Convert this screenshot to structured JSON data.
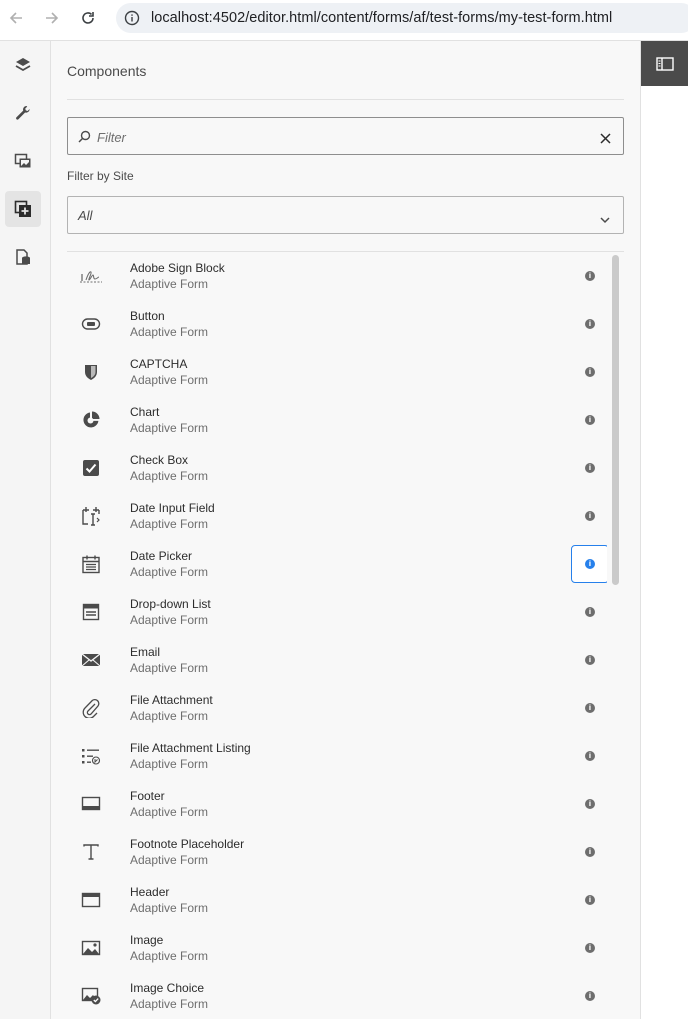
{
  "browser": {
    "url": "localhost:4502/editor.html/content/forms/af/test-forms/my-test-form.html"
  },
  "rail": {
    "items": [
      {
        "icon": "layers-icon"
      },
      {
        "icon": "wrench-icon"
      },
      {
        "icon": "assets-icon"
      },
      {
        "icon": "components-add-icon",
        "active": true
      },
      {
        "icon": "data-sources-icon"
      }
    ]
  },
  "panel": {
    "title": "Components",
    "filter_placeholder": "Filter",
    "site_label": "Filter by Site",
    "site_value": "All"
  },
  "components": [
    {
      "name": "Adobe Sign Block",
      "group": "Adaptive Form",
      "icon": "signature-icon"
    },
    {
      "name": "Button",
      "group": "Adaptive Form",
      "icon": "button-icon"
    },
    {
      "name": "CAPTCHA",
      "group": "Adaptive Form",
      "icon": "shield-icon"
    },
    {
      "name": "Chart",
      "group": "Adaptive Form",
      "icon": "pie-chart-icon"
    },
    {
      "name": "Check Box",
      "group": "Adaptive Form",
      "icon": "checkbox-icon"
    },
    {
      "name": "Date Input Field",
      "group": "Adaptive Form",
      "icon": "date-input-icon"
    },
    {
      "name": "Date Picker",
      "group": "Adaptive Form",
      "icon": "calendar-icon",
      "focused": true
    },
    {
      "name": "Drop-down List",
      "group": "Adaptive Form",
      "icon": "dropdown-list-icon"
    },
    {
      "name": "Email",
      "group": "Adaptive Form",
      "icon": "envelope-icon"
    },
    {
      "name": "File Attachment",
      "group": "Adaptive Form",
      "icon": "paperclip-icon"
    },
    {
      "name": "File Attachment Listing",
      "group": "Adaptive Form",
      "icon": "attachment-list-icon"
    },
    {
      "name": "Footer",
      "group": "Adaptive Form",
      "icon": "footer-icon"
    },
    {
      "name": "Footnote Placeholder",
      "group": "Adaptive Form",
      "icon": "text-icon"
    },
    {
      "name": "Header",
      "group": "Adaptive Form",
      "icon": "header-icon"
    },
    {
      "name": "Image",
      "group": "Adaptive Form",
      "icon": "image-icon"
    },
    {
      "name": "Image Choice",
      "group": "Adaptive Form",
      "icon": "image-choice-icon"
    }
  ]
}
